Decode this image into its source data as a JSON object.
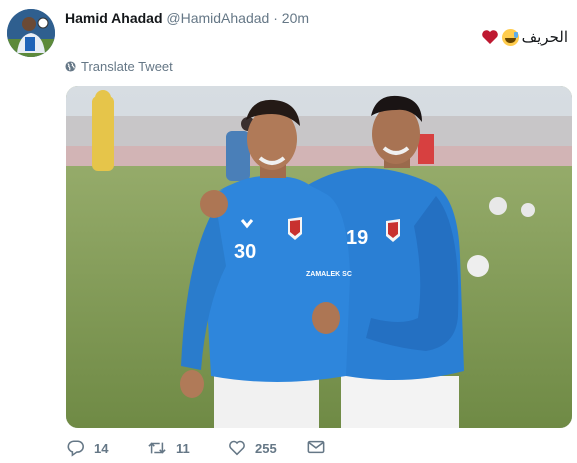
{
  "tweet": {
    "author_name": "Hamid Ahadad",
    "handle": "@HamidAhadad",
    "separator": "·",
    "time": "20m",
    "text": "الحريف",
    "emojis": [
      "grinning-sweat-emoji",
      "red-heart-emoji"
    ],
    "translate_label": "Translate Tweet"
  },
  "photo": {
    "left_jersey_number": "30",
    "right_jersey_number": "19",
    "sponsor_text": "ZAMALEK SC"
  },
  "actions": {
    "reply_count": "14",
    "retweet_count": "11",
    "like_count": "255"
  },
  "colors": {
    "accent": "#1da1f2",
    "muted": "#657786",
    "name": "#14171a",
    "jersey": "#2a7fd4"
  },
  "icons": {
    "globe": "globe-icon",
    "reply": "reply-icon",
    "retweet": "retweet-icon",
    "like": "heart-icon",
    "message": "envelope-icon"
  }
}
